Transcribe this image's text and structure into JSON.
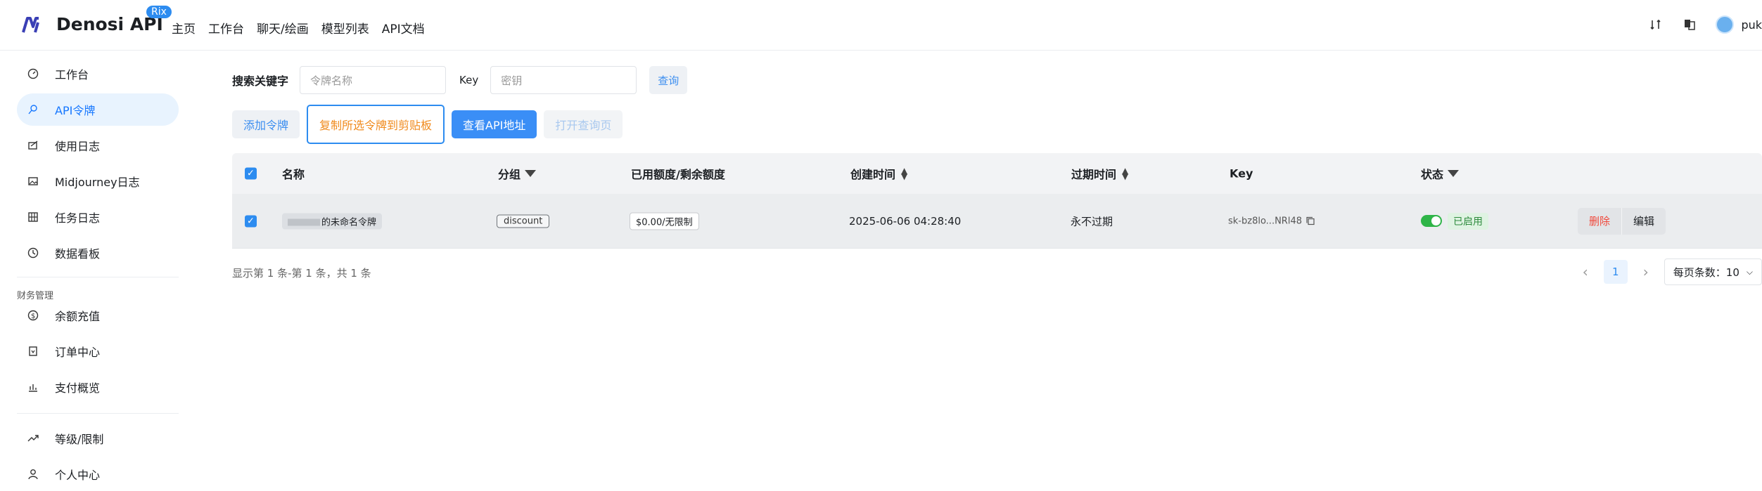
{
  "header": {
    "brand": "Denosi API",
    "badge": "Rix",
    "nav": [
      "主页",
      "工作台",
      "聊天/绘画",
      "模型列表",
      "API文档"
    ],
    "username": "puk"
  },
  "sidebar": {
    "items": [
      {
        "label": "工作台",
        "icon": "dashboard-icon"
      },
      {
        "label": "API令牌",
        "icon": "key-icon",
        "active": true
      },
      {
        "label": "使用日志",
        "icon": "log-icon"
      },
      {
        "label": "Midjourney日志",
        "icon": "image-icon"
      },
      {
        "label": "任务日志",
        "icon": "task-icon"
      },
      {
        "label": "数据看板",
        "icon": "chart-icon"
      }
    ],
    "finance_group": "财务管理",
    "finance_items": [
      {
        "label": "余额充值",
        "icon": "dollar-icon"
      },
      {
        "label": "订单中心",
        "icon": "order-icon"
      },
      {
        "label": "支付概览",
        "icon": "bar-chart-icon"
      }
    ],
    "bottom_items": [
      {
        "label": "等级/限制",
        "icon": "trend-icon"
      },
      {
        "label": "个人中心",
        "icon": "user-icon"
      }
    ]
  },
  "search": {
    "label": "搜索关键字",
    "name_placeholder": "令牌名称",
    "key_label": "Key",
    "key_placeholder": "密钥",
    "query_button": "查询"
  },
  "actions": {
    "add": "添加令牌",
    "copy": "复制所选令牌到剪贴板",
    "view_api": "查看API地址",
    "open_query": "打开查询页"
  },
  "table": {
    "headers": {
      "name": "名称",
      "group": "分组",
      "quota": "已用额度/剩余额度",
      "created": "创建时间",
      "expire": "过期时间",
      "key": "Key",
      "status": "状态"
    },
    "rows": [
      {
        "name": "的未命名令牌",
        "group": "discount",
        "quota": "$0.00/无限制",
        "created": "2025-06-06 04:28:40",
        "expire": "永不过期",
        "key": "sk-bz8lo...NRl48",
        "status": "已启用",
        "delete": "删除",
        "edit": "编辑"
      }
    ]
  },
  "footer": {
    "info": "显示第 1 条-第 1 条，共 1 条",
    "page": "1",
    "page_size": "每页条数：10"
  }
}
